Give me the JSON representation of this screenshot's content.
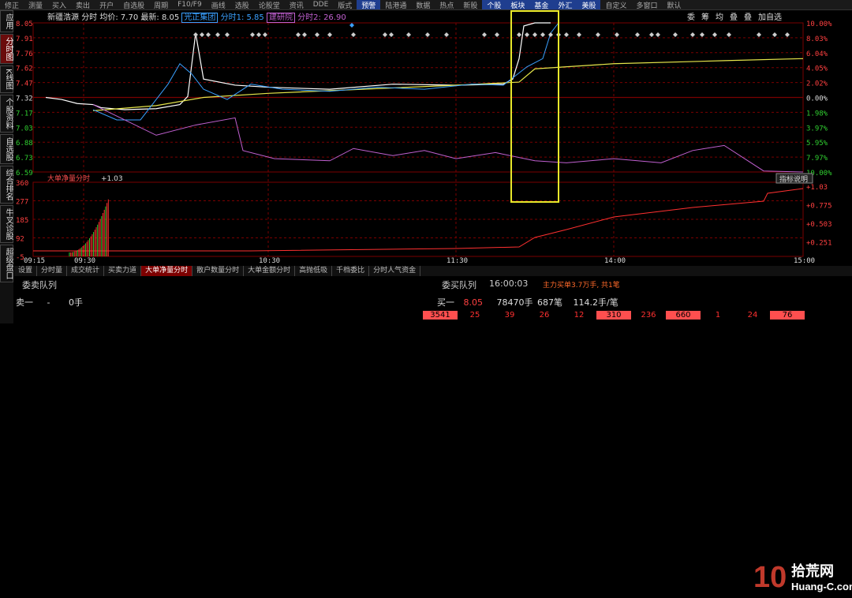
{
  "toolbar": {
    "items": [
      "修正",
      "测量",
      "买入",
      "卖出",
      "开户",
      "自选股",
      "周期",
      "F10/F9",
      "画线",
      "选股",
      "论股堂",
      "资讯",
      "DDE",
      "版式",
      "预警",
      "陆港通",
      "数据",
      "热点",
      "新股",
      "个股",
      "板块",
      "基金",
      "外汇",
      "美股",
      "自定义",
      "多窗口",
      "默认"
    ]
  },
  "left_tabs": [
    {
      "label": "应用"
    },
    {
      "label": "分时图",
      "active": true
    },
    {
      "label": "K线图"
    },
    {
      "label": "个股资料"
    },
    {
      "label": "自选股"
    },
    {
      "label": "综合排名"
    },
    {
      "label": "牛叉诊股"
    },
    {
      "label": "超级盘口"
    }
  ],
  "info_bar": {
    "name": "新疆浩源",
    "label_fenshi": "分时",
    "avg": "均价: 7.70",
    "latest": "最新: 8.05",
    "tag1": "光正集团",
    "val1": "分时1: 5.85",
    "tag2": "建研院",
    "val2": "分时2: 26.90"
  },
  "right_panel": {
    "items": [
      "委",
      "筹",
      "均",
      "叠",
      "叠",
      "加自选"
    ]
  },
  "price_axis": [
    "8.05",
    "7.91",
    "7.76",
    "7.62",
    "7.47",
    "7.32",
    "7.17",
    "7.03",
    "6.88",
    "6.73",
    "6.59"
  ],
  "pct_axis": [
    "10.00%",
    "8.03%",
    "6.04%",
    "4.05%",
    "2.02%",
    "0.00%",
    "1.98%",
    "3.97%",
    "5.95%",
    "7.97%",
    "10.00%"
  ],
  "lower_axis": [
    "360",
    "277",
    "185",
    "92",
    "-5"
  ],
  "lower_right_axis": [
    "+1.03",
    "+0.775",
    "+0.503",
    "+0.251"
  ],
  "time_axis": [
    "09:15",
    "09:30",
    "10:30",
    "11:30",
    "14:00",
    "15:00"
  ],
  "indicator": {
    "name": "大单净量分时",
    "value": "+1.03",
    "help": "指标说明"
  },
  "bottom_tabs": [
    {
      "label": "设置"
    },
    {
      "label": "分时量"
    },
    {
      "label": "成交统计"
    },
    {
      "label": "买卖力道"
    },
    {
      "label": "大单净量分时",
      "active": true
    },
    {
      "label": "散户数量分时"
    },
    {
      "label": "大单金额分时"
    },
    {
      "label": "高抛低吸"
    },
    {
      "label": "千档委比"
    },
    {
      "label": "分时人气资金"
    }
  ],
  "queue": {
    "sell_title": "委卖队列",
    "buy_title": "委买队列",
    "time": "16:00:03",
    "main_info": "主力买单3.7万手, 共1笔",
    "sell_row": {
      "label": "卖一",
      "price": "-",
      "vol": "0手"
    },
    "buy_row": {
      "label": "买一",
      "price": "8.05",
      "vol": "78470手",
      "count": "687笔",
      "avg": "114.2手/笔"
    },
    "cells": [
      "3541",
      "25",
      "39",
      "26",
      "12",
      "310",
      "236",
      "660",
      "1",
      "24",
      "76"
    ],
    "cells_filled": [
      true,
      false,
      false,
      false,
      false,
      true,
      false,
      true,
      false,
      false,
      true
    ]
  },
  "watermark": {
    "big": "10",
    "site": "拾荒网",
    "url": "Huang-C.com"
  },
  "colors": {
    "up": "#ff3030",
    "grid": "#7a0000",
    "price": "#ffffff",
    "avg": "#e6e64a",
    "blue": "#3aa0ff",
    "purple": "#c060d0",
    "highlight": "#e8e82a"
  }
}
